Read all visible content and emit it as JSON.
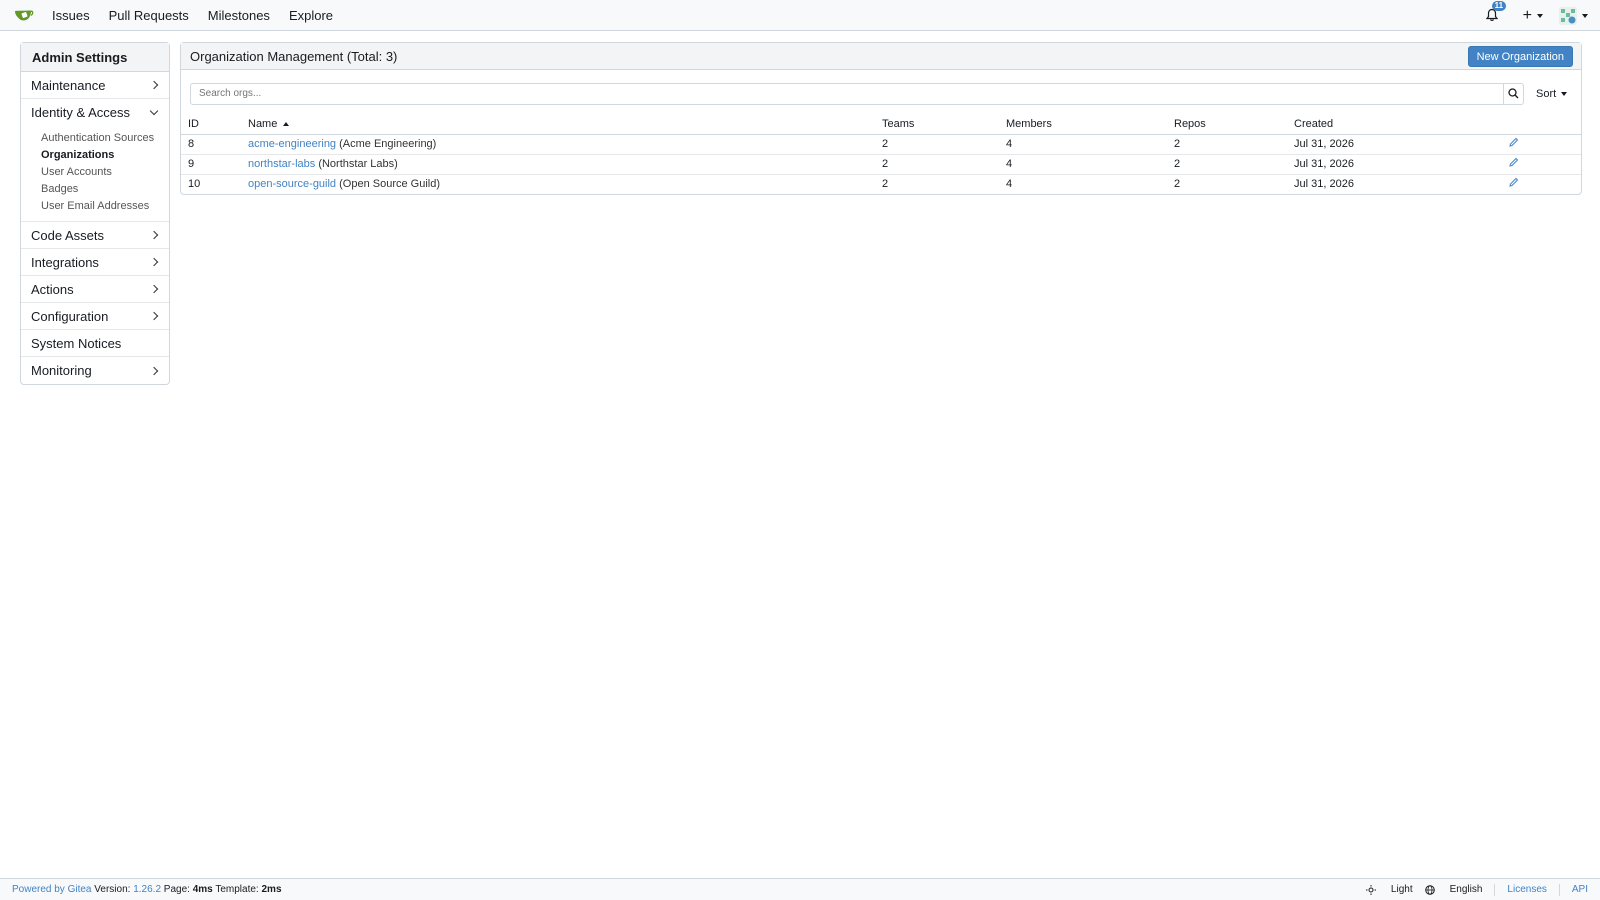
{
  "nav": {
    "links": [
      "Issues",
      "Pull Requests",
      "Milestones",
      "Explore"
    ],
    "notification_count": "11",
    "colors": {
      "accent": "#4183c4",
      "logo": "#609926"
    }
  },
  "sidebar": {
    "title": "Admin Settings",
    "items": [
      {
        "label": "Maintenance",
        "icon": "chevron-right-icon"
      },
      {
        "label": "Identity & Access",
        "icon": "chevron-down-icon",
        "expanded": true,
        "subitems": [
          "Authentication Sources",
          "Organizations",
          "User Accounts",
          "Badges",
          "User Email Addresses"
        ],
        "active_subitem": "Organizations"
      },
      {
        "label": "Code Assets",
        "icon": "chevron-right-icon"
      },
      {
        "label": "Integrations",
        "icon": "chevron-right-icon"
      },
      {
        "label": "Actions",
        "icon": "chevron-right-icon"
      },
      {
        "label": "Configuration",
        "icon": "chevron-right-icon"
      },
      {
        "label": "System Notices"
      },
      {
        "label": "Monitoring",
        "icon": "chevron-right-icon"
      }
    ]
  },
  "main": {
    "title": "Organization Management (Total: 3)",
    "new_button": "New Organization",
    "search_placeholder": "Search orgs...",
    "sort_label": "Sort",
    "columns": [
      "ID",
      "Name",
      "Teams",
      "Members",
      "Repos",
      "Created"
    ],
    "rows": [
      {
        "id": "8",
        "name": "acme-engineering",
        "full_name": "(Acme Engineering)",
        "teams": "2",
        "members": "4",
        "repos": "2",
        "created": "Jul 31, 2026"
      },
      {
        "id": "9",
        "name": "northstar-labs",
        "full_name": "(Northstar Labs)",
        "teams": "2",
        "members": "4",
        "repos": "2",
        "created": "Jul 31, 2026"
      },
      {
        "id": "10",
        "name": "open-source-guild",
        "full_name": "(Open Source Guild)",
        "teams": "2",
        "members": "4",
        "repos": "2",
        "created": "Jul 31, 2026"
      }
    ]
  },
  "footer": {
    "powered_by": "Powered by Gitea",
    "version_label": "Version:",
    "version": "1.26.2",
    "page_label": "Page:",
    "page_time": "4ms",
    "template_label": "Template:",
    "template_time": "2ms",
    "theme": "Light",
    "language": "English",
    "licenses": "Licenses",
    "api": "API"
  }
}
